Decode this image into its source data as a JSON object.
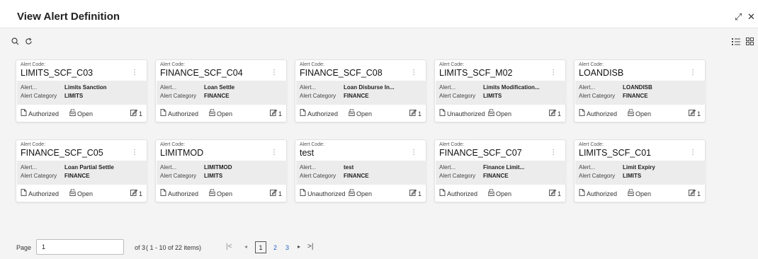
{
  "header": {
    "title": "View Alert Definition"
  },
  "card_labels": {
    "code_caption": "Alert Code:",
    "alert_name_label": "Alert...",
    "alert_category_label": "Alert Category",
    "open_label": "Open"
  },
  "cards": [
    {
      "code": "LIMITS_SCF_C03",
      "name": "Limits Sanction",
      "category": "LIMITS",
      "status": "Authorized",
      "version": "1"
    },
    {
      "code": "FINANCE_SCF_C04",
      "name": "Loan Settle",
      "category": "FINANCE",
      "status": "Authorized",
      "version": "1"
    },
    {
      "code": "FINANCE_SCF_C08",
      "name": "Loan Disburse In...",
      "category": "FINANCE",
      "status": "Authorized",
      "version": "1"
    },
    {
      "code": "LIMITS_SCF_M02",
      "name": "Limits Modification...",
      "category": "LIMITS",
      "status": "Unauthorized",
      "version": "1"
    },
    {
      "code": "LOANDISB",
      "name": "LOANDISB",
      "category": "FINANCE",
      "status": "Authorized",
      "version": "1"
    },
    {
      "code": "FINANCE_SCF_C05",
      "name": "Loan Partial Settle",
      "category": "FINANCE",
      "status": "Authorized",
      "version": "1"
    },
    {
      "code": "LIMITMOD",
      "name": "LIMITMOD",
      "category": "LIMITS",
      "status": "Authorized",
      "version": "1"
    },
    {
      "code": "test",
      "name": "test",
      "category": "FINANCE",
      "status": "Unauthorized",
      "version": "1"
    },
    {
      "code": "FINANCE_SCF_C07",
      "name": "Finance Limit...",
      "category": "FINANCE",
      "status": "Authorized",
      "version": "1"
    },
    {
      "code": "LIMITS_SCF_C01",
      "name": "Limit Expiry",
      "category": "LIMITS",
      "status": "Authorized",
      "version": "1"
    }
  ],
  "pagination": {
    "page_label": "Page",
    "page_value": "1",
    "of_text": "of 3",
    "range_text": "( 1 - 10 of 22 items)",
    "pages": [
      "1",
      "2",
      "3"
    ]
  },
  "icons": {
    "search": "search-icon",
    "refresh": "refresh-icon",
    "list_view": "list-view-icon",
    "grid_view": "grid-view-icon",
    "expand": "expand-icon",
    "close": "close-icon",
    "status": "document-icon",
    "open": "unlock-icon",
    "edit": "edit-icon",
    "kebab": "kebab-icon"
  },
  "colors": {
    "accent": "#2b63c6",
    "card_body": "#ececec",
    "page_bg": "#f4f4f4"
  }
}
